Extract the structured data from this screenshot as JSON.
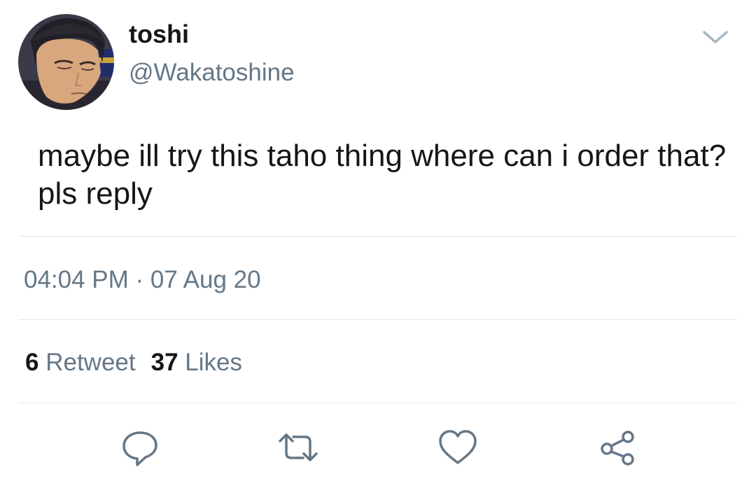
{
  "author": {
    "display_name": "toshi",
    "handle": "@Wakatoshine",
    "avatar_icon": "avatar-image"
  },
  "tweet": {
    "text": "maybe ill try this taho thing where can i order that? pls reply",
    "time": "04:04 PM",
    "separator": " · ",
    "date": "07 Aug 20"
  },
  "stats": {
    "retweets_count": "6",
    "retweets_label": "Retweet",
    "likes_count": "37",
    "likes_label": "Likes"
  },
  "actions": {
    "icons": [
      "reply-icon",
      "retweet-icon",
      "like-icon",
      "share-icon"
    ],
    "icon_color": "#657786"
  },
  "colors": {
    "text_primary": "#14171a",
    "text_secondary": "#657786",
    "divider": "#e1e8ed"
  }
}
